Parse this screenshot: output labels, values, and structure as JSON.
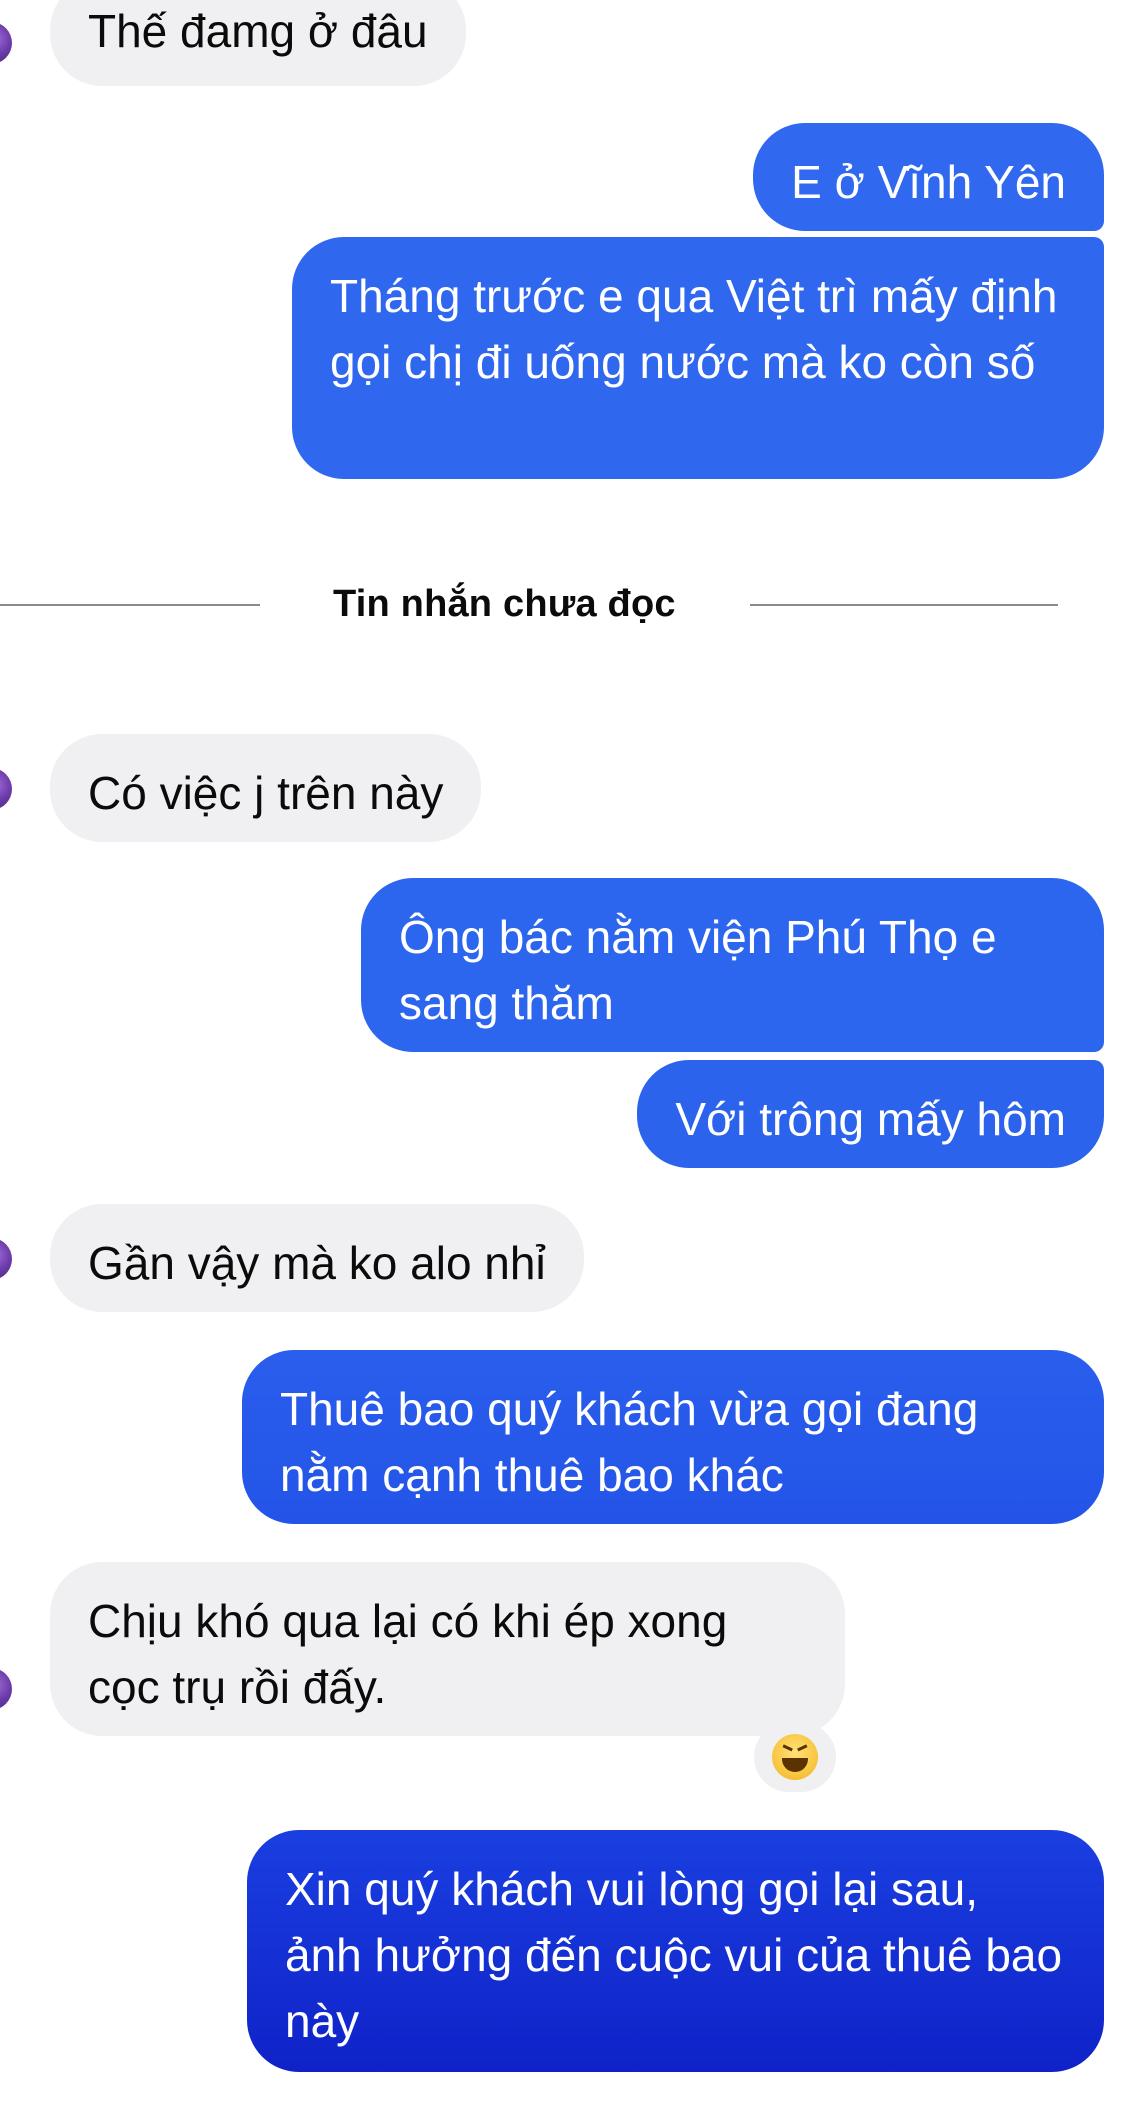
{
  "thread": {
    "unread_divider": "Tin nhắn chưa đọc",
    "messages": [
      {
        "from": "other",
        "text": "Thế đamg ở đâu"
      },
      {
        "from": "me",
        "text": "E ở Vĩnh Yên"
      },
      {
        "from": "me",
        "text": "Tháng trước e qua Việt trì mấy định gọi chị đi uống nước mà ko còn số"
      },
      {
        "from": "other",
        "text": "Có việc j trên này"
      },
      {
        "from": "me",
        "text": "Ông bác nằm viện Phú Thọ e sang thăm"
      },
      {
        "from": "me",
        "text": "Với trông mấy hôm"
      },
      {
        "from": "other",
        "text": "Gần vậy mà ko alo nhỉ"
      },
      {
        "from": "me",
        "text": "Thuê bao quý khách vừa gọi đang nằm cạnh thuê bao khác"
      },
      {
        "from": "other",
        "text": "Chịu khó qua lại có khi ép xong cọc trụ rồi đấy.",
        "reaction": "grinning-squinting-face-emoji"
      },
      {
        "from": "me",
        "text": "Xin quý khách vui lòng gọi lại sau, ảnh hưởng đến cuộc vui của thuê bao này"
      }
    ]
  },
  "colors": {
    "incoming_bubble": "#f0f0f2",
    "outgoing_top": "#2f6cf0",
    "outgoing_bottom": "#0f22c8",
    "incoming_text": "#0b0b0b",
    "outgoing_text": "#ffffff",
    "divider_line": "#8a8a8e"
  }
}
